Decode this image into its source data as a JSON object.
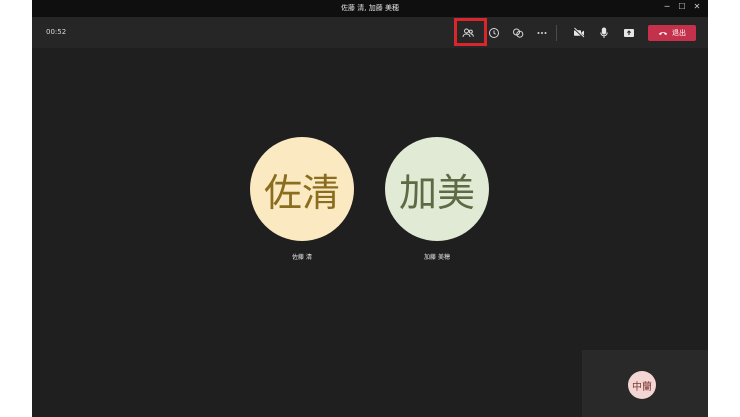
{
  "window": {
    "title": "佐藤 清, 加藤 美穂"
  },
  "window_controls": {
    "minimize": "─",
    "maximize": "☐",
    "close": "✕"
  },
  "toolbar": {
    "timer": "00:52",
    "buttons": [
      {
        "icon": "people-icon",
        "name": "participants-button"
      },
      {
        "icon": "chat-icon",
        "name": "chat-button"
      },
      {
        "icon": "reactions-icon",
        "name": "reactions-button"
      },
      {
        "icon": "more-icon",
        "name": "more-button"
      },
      {
        "icon": "camera-off-icon",
        "name": "camera-button"
      },
      {
        "icon": "mic-icon",
        "name": "mic-button"
      },
      {
        "icon": "share-icon",
        "name": "share-button"
      }
    ],
    "leave_label": "退出",
    "highlight_color": "#d8262c",
    "leave_color": "#c4314b"
  },
  "participants": [
    {
      "initials": "佐清",
      "name": "佐藤 清",
      "bg": "#fbe9c2",
      "fg": "#8a6d1f"
    },
    {
      "initials": "加美",
      "name": "加藤 美穂",
      "bg": "#e0ead5",
      "fg": "#5d6a43"
    }
  ],
  "self_view": {
    "initials": "中蘭",
    "bg": "#f3d6d3"
  }
}
